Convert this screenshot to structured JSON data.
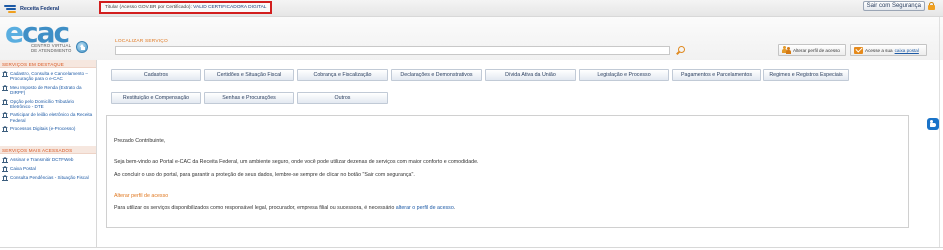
{
  "topbar": {
    "brand": "Receita Federal",
    "titular_prefix": "Titular (Acesso GOV.BR por Certificado): ",
    "titular_value": "VALID CERTIFICADORA DIGITAL",
    "exit_label": "Sair com Segurança"
  },
  "header": {
    "logo_text_e": "e",
    "logo_text_cac": "cac",
    "logo_sub_1": "CENTRO VIRTUAL",
    "logo_sub_2": "DE ATENDIMENTO",
    "search_label": "LOCALIZAR SERVIÇO",
    "search_value": "",
    "search_placeholder": "",
    "profile_label": "Alterar perfil de acesso",
    "mailbox_prefix": "Acesse a sua ",
    "mailbox_link": "caixa postal"
  },
  "sidebar": {
    "highlight_heading": "SERVIÇOS EM DESTAQUE",
    "highlight_items": [
      {
        "label": "Cadastro, Consulta e Cancelamento – Procuração para o e-CAC"
      },
      {
        "label": "Meu Imposto de Renda (Extrato da DIRPF)"
      },
      {
        "label": "Opção pelo Domicílio Tributário Eletrônico - DTE"
      },
      {
        "label": "Participar de leilão eletrônico da Receita Federal"
      },
      {
        "label": "Processos Digitais (e-Processo)"
      }
    ],
    "most_accessed_heading": "SERVIÇOS MAIS ACESSADOS",
    "most_accessed_items": [
      {
        "label": "Assinar e Transmitir DCTFWeb"
      },
      {
        "label": "Caixa Postal"
      },
      {
        "label": "Consulta Pendências - Situação Fiscal"
      }
    ]
  },
  "menu": {
    "items": [
      {
        "label": "Cadastros"
      },
      {
        "label": "Certidões e Situação Fiscal"
      },
      {
        "label": "Cobrança e Fiscalização"
      },
      {
        "label": "Declarações e Demonstrativos"
      },
      {
        "label": "Dívida Ativa da União"
      },
      {
        "label": "Legislação e Processo"
      },
      {
        "label": "Pagamentos e Parcelamentos"
      },
      {
        "label": "Regimes e Registros Especiais"
      },
      {
        "label": "Restituição e Compensação"
      },
      {
        "label": "Senhas e Procurações"
      },
      {
        "label": "Outros"
      }
    ]
  },
  "content": {
    "greeting": "Prezado Contribuinte,",
    "welcome": "Seja bem-vindo ao Portal e-CAC da Receita Federal, um ambiente seguro, onde você pode utilizar dezenas de serviços com maior conforto e comodidade.",
    "logout_hint": "Ao concluir o uso do portal, para garantir a proteção de seus dados, lembre-se sempre de clicar no botão \"Sair com segurança\".",
    "profile_heading": "Alterar perfil de acesso",
    "profile_text": "Para utilizar os serviços disponibilizados como responsável legal, procurador, empresa filial ou sucessora, é necessário ",
    "profile_link": "alterar o perfil de acesso",
    "profile_end": "."
  },
  "colors": {
    "accent_orange": "#e07820",
    "link_blue": "#1d5aa6",
    "highlight_red": "#d21e1e"
  }
}
